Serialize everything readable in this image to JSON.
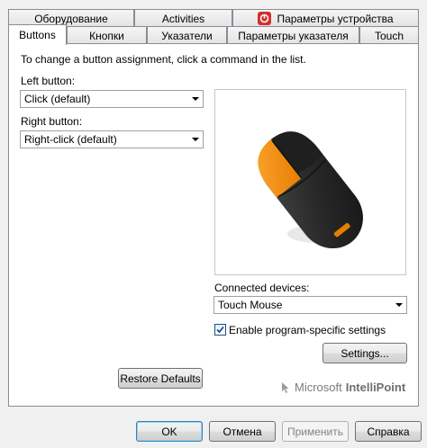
{
  "tabs_row1": [
    {
      "label": "Оборудование"
    },
    {
      "label": "Activities"
    },
    {
      "label": "Параметры устройства"
    }
  ],
  "tabs_row2": [
    {
      "label": "Buttons"
    },
    {
      "label": "Кнопки"
    },
    {
      "label": "Указатели"
    },
    {
      "label": "Параметры указателя"
    },
    {
      "label": "Touch"
    }
  ],
  "panel": {
    "instruction": "To change a button assignment, click a command in the list.",
    "left_button_label": "Left button:",
    "left_button_value": "Click (default)",
    "right_button_label": "Right button:",
    "right_button_value": "Right-click (default)",
    "connected_label": "Connected devices:",
    "connected_value": "Touch Mouse",
    "enable_program_label": "Enable program-specific settings",
    "enable_program_checked": true,
    "settings_button": "Settings...",
    "restore_button": "Restore Defaults",
    "brand_microsoft": "Microsoft",
    "brand_product": "IntelliPoint"
  },
  "dialog_buttons": {
    "ok": "OK",
    "cancel": "Отмена",
    "apply": "Применить",
    "help": "Справка"
  },
  "colors": {
    "mouse_accent": "#f7931e",
    "mouse_body": "#2b2b2b",
    "device_icon": "#d32f2f"
  }
}
